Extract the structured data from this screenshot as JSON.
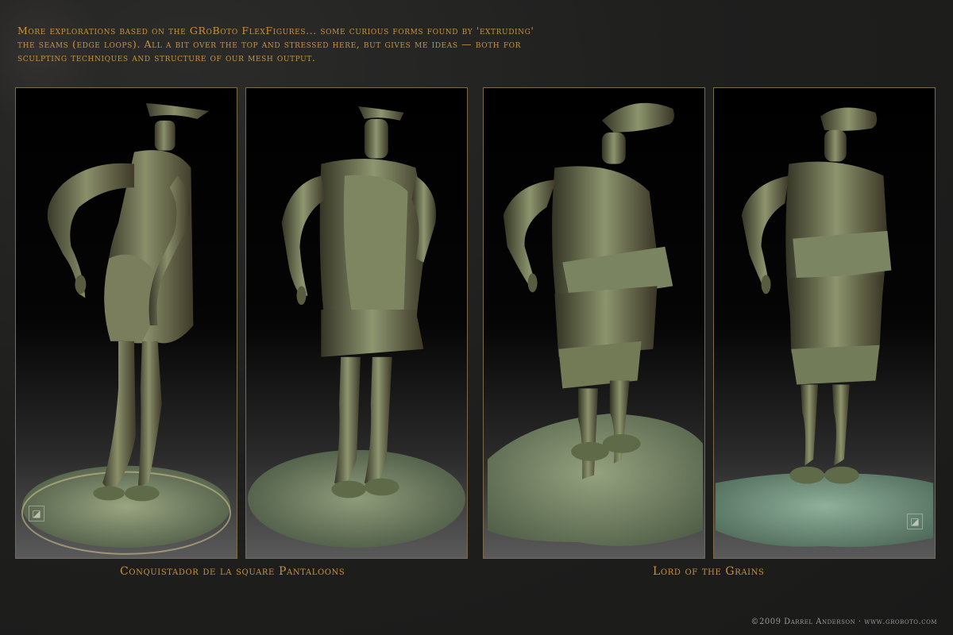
{
  "intro": {
    "lines": [
      "More explorations based on the GRoBoto FlexFigures... some curious forms found by 'extruding'",
      "the seams (edge loops). All a bit over the top and stressed here, but gives me ideas — both for",
      "sculpting techniques and structure of our mesh output."
    ]
  },
  "captions": {
    "left": "Conquistador de la square Pantaloons",
    "right": "Lord of the Grains"
  },
  "credit": "©2009 Darrel Anderson · www.groboto.com",
  "logo_glyph": "◪",
  "colors": {
    "accent": "#c8923f",
    "frame": "#7d6a4a",
    "bronze": "#6f7a5a"
  }
}
